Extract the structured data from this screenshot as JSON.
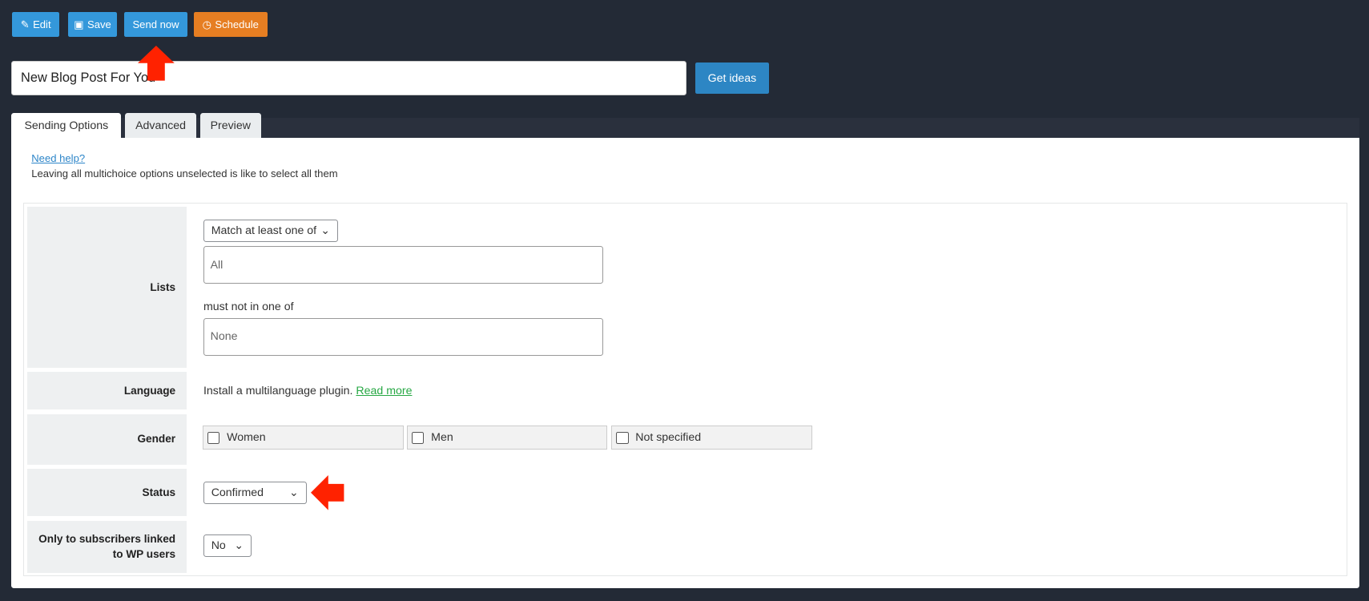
{
  "toolbar": {
    "edit": "Edit",
    "save": "Save",
    "send_now": "Send now",
    "schedule": "Schedule",
    "colors": {
      "primary": "#3498db",
      "schedule": "#e67e22"
    }
  },
  "subject": {
    "value": "New Blog Post For You"
  },
  "get_ideas": "Get ideas",
  "tabs": [
    {
      "label": "Sending Options",
      "active": true
    },
    {
      "label": "Advanced"
    },
    {
      "label": "Preview"
    }
  ],
  "help": {
    "link": "Need help?",
    "note": "Leaving all multichoice options unselected is like to select all them"
  },
  "rows": {
    "lists": {
      "label": "Lists",
      "match_select": "Match at least one of",
      "include_value": "All",
      "exclude_label": "must not in one of",
      "exclude_value": "None"
    },
    "language": {
      "label": "Language",
      "text": "Install a multilanguage plugin.",
      "link": "Read more"
    },
    "gender": {
      "label": "Gender",
      "options": [
        {
          "label": "Women",
          "checked": false
        },
        {
          "label": "Men",
          "checked": false
        },
        {
          "label": "Not specified",
          "checked": false
        }
      ]
    },
    "status": {
      "label": "Status",
      "value": "Confirmed"
    },
    "wp_users": {
      "label": "Only to subscribers linked to WP users",
      "value": "No"
    }
  },
  "annotations": {
    "arrow_color": "#ff2200"
  }
}
